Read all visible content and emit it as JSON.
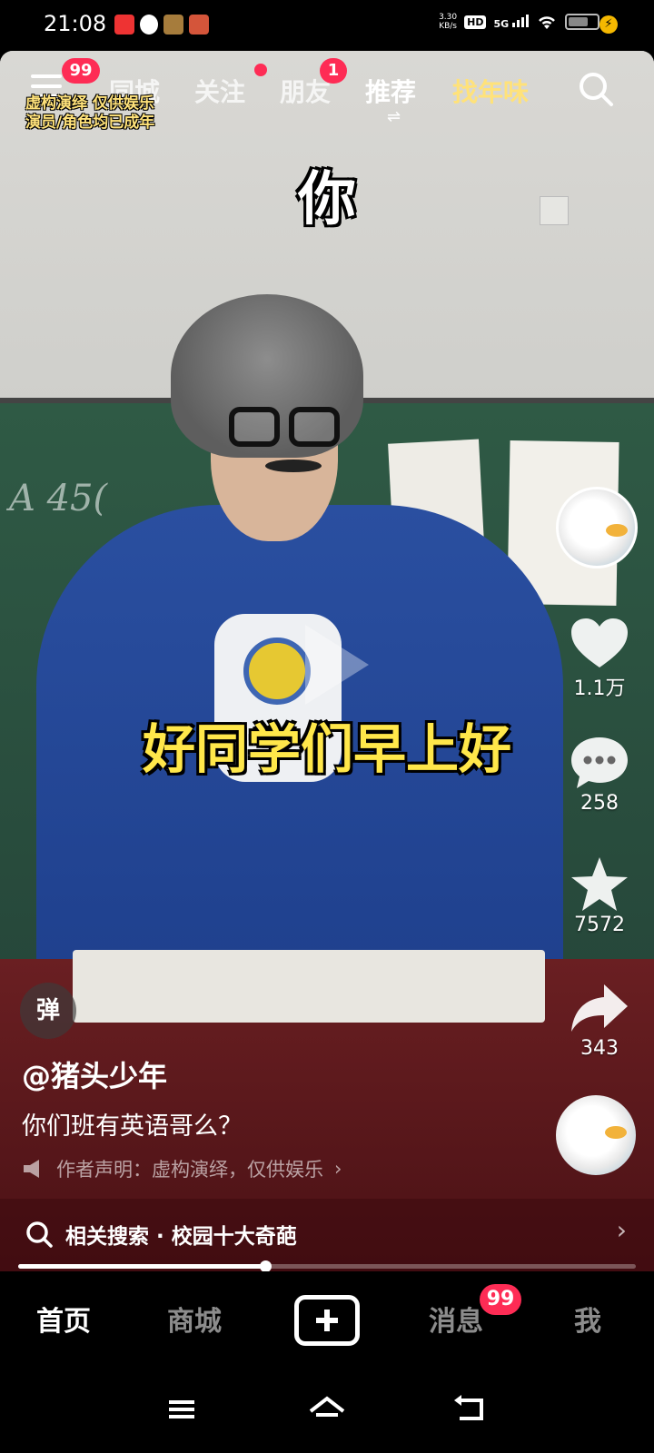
{
  "status_bar": {
    "time": "21:08",
    "net_speed_value": "3.30",
    "net_speed_unit": "KB/s",
    "hd": "HD",
    "network": "5G",
    "battery_level": 0.62
  },
  "top_nav": {
    "menu_badge": "99",
    "tabs": [
      {
        "label": "同城"
      },
      {
        "label": "关注"
      },
      {
        "label": "朋友",
        "badge": "1"
      },
      {
        "label": "推荐"
      },
      {
        "label": "找年味"
      }
    ],
    "switch_glyph": "⇌",
    "disclaimer_line1": "虚构演绎 仅供娱乐",
    "disclaimer_line2": "演员/角色均已成年"
  },
  "video": {
    "chalk_text": "A 45(",
    "caption_top": "你",
    "caption_main": "好同学们早上好",
    "danmu_button": "弹",
    "progress": 0.4
  },
  "right_rail": {
    "likes": "1.1万",
    "comments": "258",
    "favorites": "7572",
    "shares": "343"
  },
  "info": {
    "author": "@猪头少年",
    "description": "你们班有英语哥么？",
    "declaration": "作者声明：虚构演绎，仅供娱乐",
    "declaration_chevron": "›",
    "related_search": "相关搜索 · 校园十大奇葩",
    "related_chevron": "›"
  },
  "tab_bar": {
    "home": "首页",
    "mall": "商城",
    "messages": "消息",
    "messages_badge": "99",
    "me": "我"
  },
  "colors": {
    "accent_red": "#fe2c55",
    "caption_yellow": "#ffe74a",
    "special_tab": "#ffe27a"
  }
}
